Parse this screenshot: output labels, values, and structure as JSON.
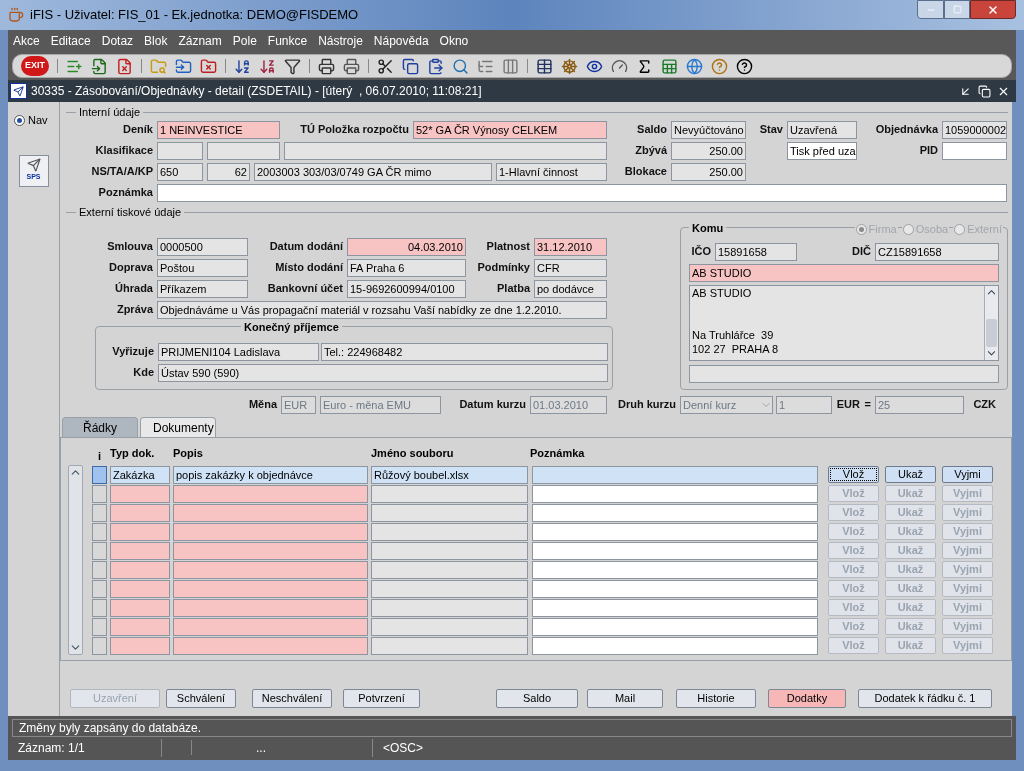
{
  "window": {
    "title": "iFIS - Uživatel: FIS_01 - Ek.jednotka: DEMO@FISDEMO"
  },
  "menu": [
    "Akce",
    "Editace",
    "Dotaz",
    "Blok",
    "Záznam",
    "Pole",
    "Funkce",
    "Nástroje",
    "Nápověda",
    "Okno"
  ],
  "toolbar": {
    "exit_label": "EXIT"
  },
  "form": {
    "title": "30335 - Zásobování/Objednávky - detail (ZSDETAIL) - [úterý  , 06.07.2010; 11:08:21]"
  },
  "nav": {
    "label": "Nav",
    "selected": true,
    "sps_label": "SPS"
  },
  "internal": {
    "legend": "Interní údaje",
    "lines": [
      {
        "items": [
          {
            "kind": "label",
            "text": "Deník"
          },
          {
            "kind": "field",
            "value": "1 NEINVESTICE",
            "required": true
          },
          {
            "kind": "label",
            "text": "TÚ Položka rozpočtu"
          },
          {
            "kind": "field",
            "value": "52* GA ČR Výnosy CELKEM",
            "required": true
          },
          {
            "kind": "label",
            "text": "Saldo"
          },
          {
            "kind": "field",
            "value": "Nevyúčtováno",
            "required": false,
            "editable": false
          },
          {
            "kind": "label",
            "text": "Stav"
          },
          {
            "kind": "field",
            "value": "Uzavřená",
            "required": false,
            "editable": false
          },
          {
            "kind": "label",
            "text": "Objednávka"
          },
          {
            "kind": "field",
            "value": "1059000002",
            "required": false,
            "editable": false
          }
        ]
      },
      {
        "items": [
          {
            "kind": "label",
            "text": "Klasifikace"
          },
          {
            "kind": "field",
            "required": false,
            "editable": false
          },
          {
            "kind": "field",
            "required": false,
            "editable": false
          },
          {
            "kind": "field",
            "required": false,
            "editable": false
          },
          {
            "kind": "label",
            "text": "Zbývá"
          },
          {
            "kind": "field",
            "value": "250.00",
            "required": false,
            "editable": false
          },
          {
            "kind": "field",
            "value": "Tisk před uza",
            "required": false,
            "editable": true
          },
          {
            "kind": "label",
            "text": "PID"
          },
          {
            "kind": "field",
            "required": false,
            "editable": true
          }
        ]
      },
      {
        "items": [
          {
            "kind": "label",
            "text": "NS/TA/A/KP"
          },
          {
            "kind": "field",
            "value": "650",
            "required": false,
            "editable": false
          },
          {
            "kind": "field",
            "value": "62",
            "required": false,
            "editable": false
          },
          {
            "kind": "field",
            "value": "2003003 303/03/0749 GA ČR mimo",
            "required": false,
            "editable": false
          },
          {
            "kind": "field",
            "value": "1-Hlavní činnost",
            "required": false,
            "editable": false
          },
          {
            "kind": "label",
            "text": "Blokace"
          },
          {
            "kind": "field",
            "value": "250.00",
            "required": false,
            "editable": false
          }
        ]
      },
      {
        "items": [
          {
            "kind": "label",
            "text": "Poznámka"
          },
          {
            "kind": "field",
            "required": false,
            "editable": true
          }
        ]
      }
    ]
  },
  "external": {
    "legend": "Externí tiskové údaje",
    "lines": [
      {
        "items": [
          {
            "kind": "label",
            "text": "Smlouva"
          },
          {
            "kind": "field",
            "value": "0000500",
            "required": false,
            "editable": false
          },
          {
            "kind": "label",
            "text": "Datum dodání"
          },
          {
            "kind": "field",
            "value": "04.03.2010",
            "required": true
          },
          {
            "kind": "label",
            "text": "Platnost"
          },
          {
            "kind": "field",
            "value": "31.12.2010",
            "required": true
          }
        ]
      },
      {
        "items": [
          {
            "kind": "label",
            "text": "Doprava"
          },
          {
            "kind": "field",
            "value": "Poštou",
            "required": false,
            "editable": false
          },
          {
            "kind": "label",
            "text": "Místo dodání"
          },
          {
            "kind": "field",
            "value": "FA Praha 6",
            "required": false,
            "editable": false
          },
          {
            "kind": "label",
            "text": "Podmínky"
          },
          {
            "kind": "field",
            "value": "CFR",
            "required": false,
            "editable": false
          }
        ]
      },
      {
        "items": [
          {
            "kind": "label",
            "text": "Úhrada"
          },
          {
            "kind": "field",
            "value": "Příkazem",
            "required": false,
            "editable": false
          },
          {
            "kind": "label",
            "text": "Bankovní účet"
          },
          {
            "kind": "field",
            "value": "15-9692600994/0100",
            "required": false,
            "editable": false
          },
          {
            "kind": "label",
            "text": "Platba"
          },
          {
            "kind": "field",
            "value": "po dodávce",
            "required": false,
            "editable": false
          }
        ]
      },
      {
        "items": [
          {
            "kind": "label",
            "text": "Zpráva"
          },
          {
            "kind": "field",
            "value": "Objednáváme u Vás propagační materiál v rozsahu Vaší nabídky ze dne 1.2.2010.",
            "required": false,
            "editable": false
          }
        ]
      }
    ],
    "recipient": {
      "legend": "Konečný příjemce",
      "lines": [
        {
          "items": [
            {
              "kind": "label",
              "text": "Vyřizuje"
            },
            {
              "kind": "field",
              "value": "PRIJMENI104 Ladislava",
              "required": false,
              "editable": false
            },
            {
              "kind": "field",
              "value": "Tel.: 224968482",
              "required": false,
              "editable": false
            }
          ]
        },
        {
          "items": [
            {
              "kind": "label",
              "text": "Kde"
            },
            {
              "kind": "field",
              "value": "Ústav 590 (590)",
              "required": false,
              "editable": false
            }
          ]
        }
      ]
    },
    "addressee": {
      "legend": "Komu",
      "options": [
        {
          "label": "Firma",
          "selected": true,
          "disabled": true
        },
        {
          "label": "Osoba",
          "selected": false,
          "disabled": true
        },
        {
          "label": "Externí",
          "selected": false,
          "disabled": true
        }
      ],
      "ids": [
        {
          "kind": "label",
          "text": "IČO"
        },
        {
          "kind": "field",
          "value": "15891658",
          "required": false,
          "editable": false
        },
        {
          "kind": "label",
          "text": "DIČ"
        },
        {
          "kind": "field",
          "value": "CZ15891658",
          "required": false,
          "editable": false
        }
      ],
      "name": {
        "value": "AB STUDIO",
        "required": true
      },
      "address": {
        "value": "AB STUDIO\n\n\nNa Truhlářce  39\n102 27  PRAHA 8",
        "required": false,
        "editable": false
      },
      "note": {
        "required": false,
        "editable": false
      }
    },
    "currency": [
      {
        "kind": "label",
        "text": "Měna"
      },
      {
        "kind": "field",
        "value": "EUR",
        "required": false,
        "editable": false,
        "disabled": true
      },
      {
        "kind": "field",
        "value": "Euro - měna EMU",
        "required": false,
        "editable": false,
        "disabled": true
      },
      {
        "kind": "label",
        "text": "Datum kurzu"
      },
      {
        "kind": "field",
        "value": "01.03.2010",
        "required": false,
        "editable": false,
        "disabled": true
      },
      {
        "kind": "label",
        "text": "Druh kurzu"
      },
      {
        "kind": "select",
        "value": "Denní kurz",
        "required": false,
        "editable": false,
        "disabled": true
      },
      {
        "kind": "field",
        "value": "1",
        "required": false,
        "editable": false,
        "disabled": true
      },
      {
        "kind": "label",
        "text": "EUR"
      },
      {
        "kind": "label",
        "text": "="
      },
      {
        "kind": "field",
        "value": "25",
        "required": false,
        "editable": false,
        "disabled": true
      },
      {
        "kind": "label",
        "text": "CZK"
      }
    ]
  },
  "tabs": [
    {
      "label": "Řádky",
      "selected": false
    },
    {
      "label": "Dokumenty",
      "selected": true
    }
  ],
  "documents": {
    "columns": [
      "i",
      "Typ dok.",
      "Popis",
      "Jméno souboru",
      "Poznámka"
    ],
    "rows": [
      {
        "selected": true,
        "type": "Zakázka",
        "description": "popis zakázky k objednávce",
        "file": "Růžový boubel.xlsx",
        "buttons": [
          {
            "label": "Vlož",
            "disabled": false,
            "focused": true
          },
          {
            "label": "Ukaž",
            "disabled": false,
            "focused": false
          },
          {
            "label": "Vyjmi",
            "disabled": false,
            "focused": false
          }
        ]
      },
      {
        "selected": false,
        "buttons": [
          {
            "label": "Vlož",
            "disabled": true,
            "focused": false
          },
          {
            "label": "Ukaž",
            "disabled": true,
            "focused": false
          },
          {
            "label": "Vyjmi",
            "disabled": true,
            "focused": false
          }
        ]
      },
      {
        "selected": false,
        "buttons": [
          {
            "label": "Vlož",
            "disabled": true,
            "focused": false
          },
          {
            "label": "Ukaž",
            "disabled": true,
            "focused": false
          },
          {
            "label": "Vyjmi",
            "disabled": true,
            "focused": false
          }
        ]
      },
      {
        "selected": false,
        "buttons": [
          {
            "label": "Vlož",
            "disabled": true,
            "focused": false
          },
          {
            "label": "Ukaž",
            "disabled": true,
            "focused": false
          },
          {
            "label": "Vyjmi",
            "disabled": true,
            "focused": false
          }
        ]
      },
      {
        "selected": false,
        "buttons": [
          {
            "label": "Vlož",
            "disabled": true,
            "focused": false
          },
          {
            "label": "Ukaž",
            "disabled": true,
            "focused": false
          },
          {
            "label": "Vyjmi",
            "disabled": true,
            "focused": false
          }
        ]
      },
      {
        "selected": false,
        "buttons": [
          {
            "label": "Vlož",
            "disabled": true,
            "focused": false
          },
          {
            "label": "Ukaž",
            "disabled": true,
            "focused": false
          },
          {
            "label": "Vyjmi",
            "disabled": true,
            "focused": false
          }
        ]
      },
      {
        "selected": false,
        "buttons": [
          {
            "label": "Vlož",
            "disabled": true,
            "focused": false
          },
          {
            "label": "Ukaž",
            "disabled": true,
            "focused": false
          },
          {
            "label": "Vyjmi",
            "disabled": true,
            "focused": false
          }
        ]
      },
      {
        "selected": false,
        "buttons": [
          {
            "label": "Vlož",
            "disabled": true,
            "focused": false
          },
          {
            "label": "Ukaž",
            "disabled": true,
            "focused": false
          },
          {
            "label": "Vyjmi",
            "disabled": true,
            "focused": false
          }
        ]
      },
      {
        "selected": false,
        "buttons": [
          {
            "label": "Vlož",
            "disabled": true,
            "focused": false
          },
          {
            "label": "Ukaž",
            "disabled": true,
            "focused": false
          },
          {
            "label": "Vyjmi",
            "disabled": true,
            "focused": false
          }
        ]
      },
      {
        "selected": false,
        "buttons": [
          {
            "label": "Vlož",
            "disabled": true,
            "focused": false
          },
          {
            "label": "Ukaž",
            "disabled": true,
            "focused": false
          },
          {
            "label": "Vyjmi",
            "disabled": true,
            "focused": false
          }
        ]
      }
    ]
  },
  "actions": [
    {
      "label": "Uzavření",
      "disabled": true,
      "highlighted": false
    },
    {
      "label": "Schválení",
      "disabled": false,
      "highlighted": false
    },
    {
      "label": "Neschválení",
      "disabled": false,
      "highlighted": false
    },
    {
      "label": "Potvrzení",
      "disabled": false,
      "highlighted": false
    },
    {
      "label": "Saldo",
      "disabled": false,
      "highlighted": false
    },
    {
      "label": "Mail",
      "disabled": false,
      "highlighted": false
    },
    {
      "label": "Historie",
      "disabled": false,
      "highlighted": false
    },
    {
      "label": "Dodatky",
      "disabled": false,
      "highlighted": true
    },
    {
      "label": "Dodatek k řádku č. 1",
      "disabled": false,
      "highlighted": false
    }
  ],
  "status": {
    "message": "Změny byly zapsány do databáze.",
    "record": "Záznam: 1/1",
    "cells": [
      "...",
      "<OSC>"
    ]
  }
}
